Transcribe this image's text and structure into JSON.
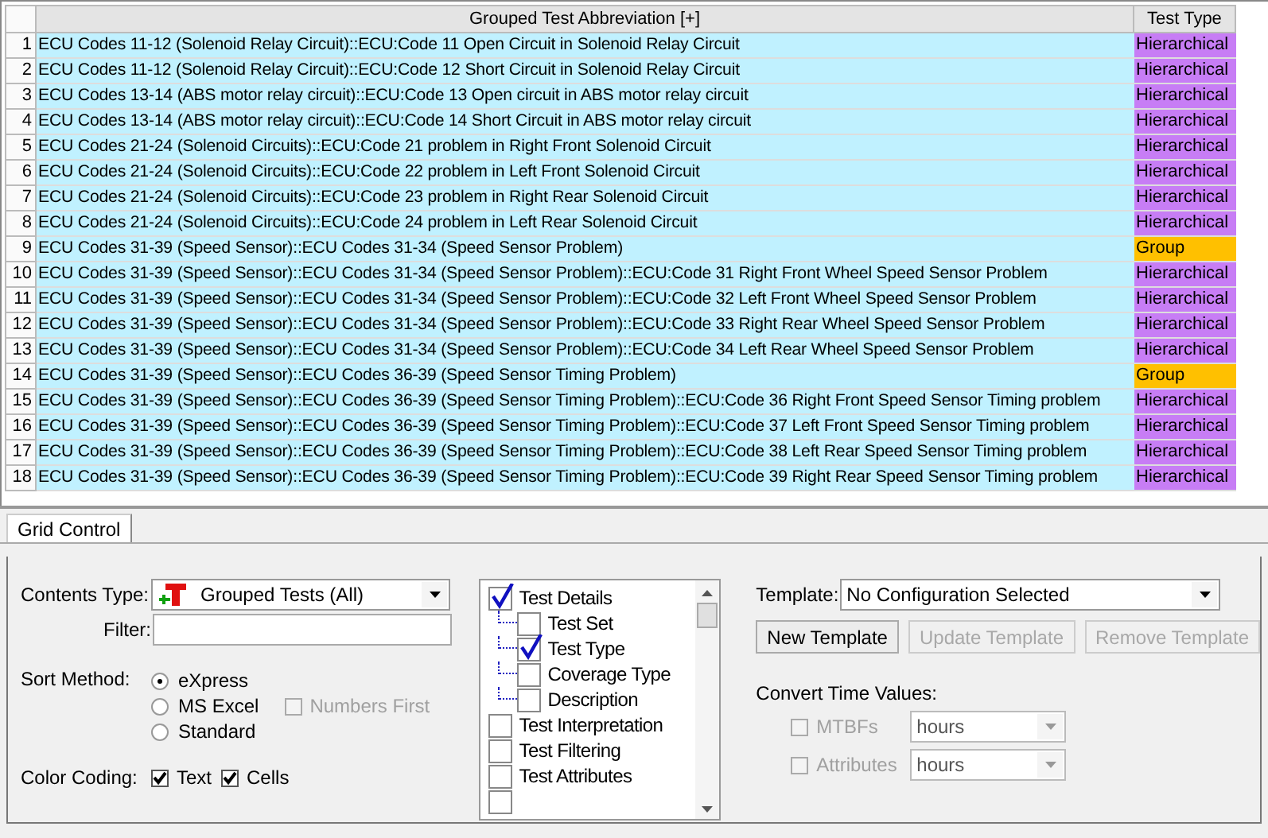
{
  "grid": {
    "columns": [
      "Grouped Test Abbreviation [+]",
      "Test Type"
    ],
    "rows": [
      {
        "number": "1",
        "abbreviation": "ECU Codes 11-12 (Solenoid Relay Circuit)::ECU:Code 11 Open Circuit in Solenoid Relay Circuit",
        "type": "Hierarchical",
        "color": "#c77df5"
      },
      {
        "number": "2",
        "abbreviation": "ECU Codes 11-12 (Solenoid Relay Circuit)::ECU:Code 12 Short Circuit in Solenoid Relay Circuit",
        "type": "Hierarchical",
        "color": "#c77df5"
      },
      {
        "number": "3",
        "abbreviation": "ECU Codes 13-14 (ABS motor relay circuit)::ECU:Code 13 Open circuit in ABS motor relay circuit",
        "type": "Hierarchical",
        "color": "#c77df5"
      },
      {
        "number": "4",
        "abbreviation": "ECU Codes 13-14 (ABS motor relay circuit)::ECU:Code 14 Short Circuit in ABS motor relay circuit",
        "type": "Hierarchical",
        "color": "#c77df5"
      },
      {
        "number": "5",
        "abbreviation": "ECU Codes 21-24 (Solenoid Circuits)::ECU:Code 21 problem in Right Front Solenoid Circuit",
        "type": "Hierarchical",
        "color": "#c77df5"
      },
      {
        "number": "6",
        "abbreviation": "ECU Codes 21-24 (Solenoid Circuits)::ECU:Code 22 problem in Left Front Solenoid Circuit",
        "type": "Hierarchical",
        "color": "#c77df5"
      },
      {
        "number": "7",
        "abbreviation": "ECU Codes 21-24 (Solenoid Circuits)::ECU:Code 23 problem in Right Rear Solenoid Circuit",
        "type": "Hierarchical",
        "color": "#c77df5"
      },
      {
        "number": "8",
        "abbreviation": "ECU Codes 21-24 (Solenoid Circuits)::ECU:Code 24 problem in Left Rear Solenoid Circuit",
        "type": "Hierarchical",
        "color": "#c77df5"
      },
      {
        "number": "9",
        "abbreviation": "ECU Codes 31-39 (Speed Sensor)::ECU Codes 31-34 (Speed Sensor Problem)",
        "type": "Group",
        "color": "#ffc000"
      },
      {
        "number": "10",
        "abbreviation": "ECU Codes 31-39 (Speed Sensor)::ECU Codes 31-34 (Speed Sensor Problem)::ECU:Code 31 Right Front Wheel Speed Sensor Problem",
        "type": "Hierarchical",
        "color": "#c77df5"
      },
      {
        "number": "11",
        "abbreviation": "ECU Codes 31-39 (Speed Sensor)::ECU Codes 31-34 (Speed Sensor Problem)::ECU:Code 32 Left Front Wheel Speed Sensor Problem",
        "type": "Hierarchical",
        "color": "#c77df5"
      },
      {
        "number": "12",
        "abbreviation": "ECU Codes 31-39 (Speed Sensor)::ECU Codes 31-34 (Speed Sensor Problem)::ECU:Code 33 Right Rear Wheel Speed Sensor Problem",
        "type": "Hierarchical",
        "color": "#c77df5"
      },
      {
        "number": "13",
        "abbreviation": "ECU Codes 31-39 (Speed Sensor)::ECU Codes 31-34 (Speed Sensor Problem)::ECU:Code 34 Left Rear Wheel Speed Sensor Problem",
        "type": "Hierarchical",
        "color": "#c77df5"
      },
      {
        "number": "14",
        "abbreviation": "ECU Codes 31-39 (Speed Sensor)::ECU Codes 36-39 (Speed Sensor Timing Problem)",
        "type": "Group",
        "color": "#ffc000"
      },
      {
        "number": "15",
        "abbreviation": "ECU Codes 31-39 (Speed Sensor)::ECU Codes 36-39 (Speed Sensor Timing Problem)::ECU:Code 36 Right Front Speed Sensor Timing problem",
        "type": "Hierarchical",
        "color": "#c77df5"
      },
      {
        "number": "16",
        "abbreviation": "ECU Codes 31-39 (Speed Sensor)::ECU Codes 36-39 (Speed Sensor Timing Problem)::ECU:Code 37 Left Front Speed Sensor Timing problem",
        "type": "Hierarchical",
        "color": "#c77df5"
      },
      {
        "number": "17",
        "abbreviation": "ECU Codes 31-39 (Speed Sensor)::ECU Codes 36-39 (Speed Sensor Timing Problem)::ECU:Code 38 Left Rear Speed Sensor Timing problem",
        "type": "Hierarchical",
        "color": "#c77df5"
      },
      {
        "number": "18",
        "abbreviation": "ECU Codes 31-39 (Speed Sensor)::ECU Codes 36-39 (Speed Sensor Timing Problem)::ECU:Code 39 Right Rear Speed Sensor Timing problem",
        "type": "Hierarchical",
        "color": "#c77df5"
      }
    ]
  },
  "tabs": [
    {
      "label": "Grid Control",
      "selected": true
    }
  ],
  "contents_type": {
    "label": "Contents Type:",
    "value": "Grouped Tests (All)"
  },
  "filter": {
    "label": "Filter:"
  },
  "sort_method": {
    "label": "Sort Method:",
    "options": [
      {
        "label": "eXpress",
        "selected": true
      },
      {
        "label": "MS Excel",
        "selected": false
      },
      {
        "label": "Standard",
        "selected": false
      }
    ],
    "numbers_first": {
      "label": "Numbers First",
      "checked": false,
      "disabled": true
    }
  },
  "color_coding": {
    "label": "Color Coding:",
    "options": [
      {
        "label": "Text",
        "checked": true
      },
      {
        "label": "Cells",
        "checked": true
      }
    ]
  },
  "columns_tree": [
    {
      "label": "Test Details",
      "checked": true,
      "children": [
        {
          "label": "Test Set",
          "checked": false
        },
        {
          "label": "Test Type",
          "checked": true
        },
        {
          "label": "Coverage Type",
          "checked": false
        },
        {
          "label": "Description",
          "checked": false
        }
      ]
    },
    {
      "label": "Test Interpretation",
      "checked": false
    },
    {
      "label": "Test Filtering",
      "checked": false
    },
    {
      "label": "Test Attributes",
      "checked": false
    },
    {
      "checked": false
    }
  ],
  "template": {
    "label": "Template:",
    "value": "No Configuration Selected"
  },
  "template_buttons": [
    {
      "label": "New Template",
      "disabled": false
    },
    {
      "label": "Update Template",
      "disabled": true
    },
    {
      "label": "Remove Template",
      "disabled": true
    }
  ],
  "convert_time": {
    "label": "Convert Time Values:",
    "items": [
      {
        "label": "MTBFs",
        "checked": false,
        "disabled": true,
        "unit": "hours"
      },
      {
        "label": "Attributes",
        "checked": false,
        "disabled": true,
        "unit": "hours"
      }
    ]
  }
}
